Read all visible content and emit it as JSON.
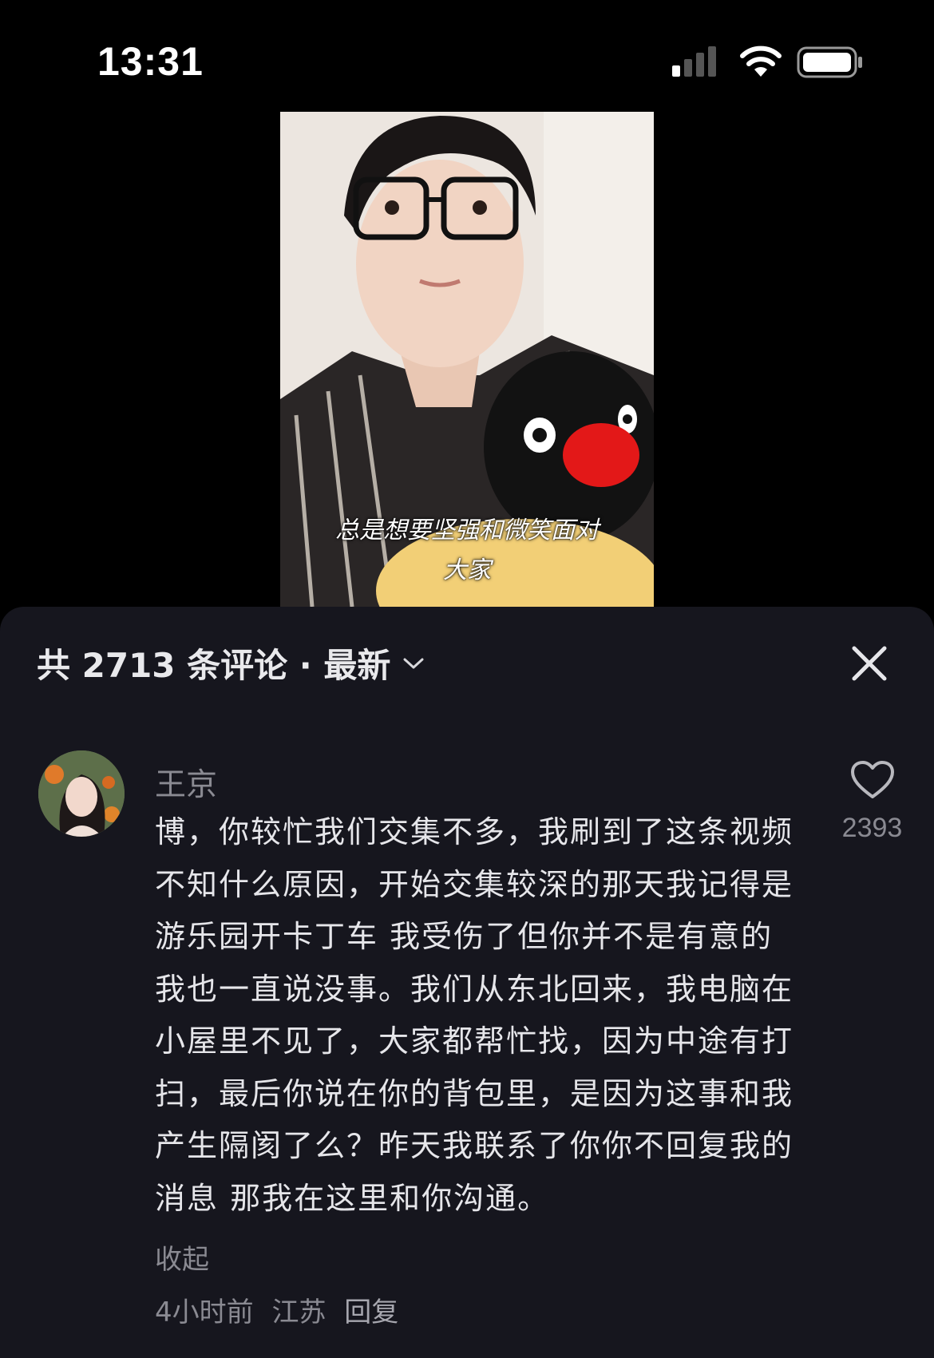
{
  "status_bar": {
    "time": "13:31"
  },
  "video": {
    "caption_line1": "总是想要坚强和微笑面对",
    "caption_line2": "大家"
  },
  "comments_panel": {
    "title": "共 2713 条评论 · 最新",
    "close_icon": "close-icon",
    "sort_icon": "chevron-down-icon"
  },
  "comment": {
    "username": "王京",
    "text": "博，你较忙我们交集不多，我刷到了这条视频不知什么原因，开始交集较深的那天我记得是游乐园开卡丁车 我受伤了但你并不是有意的我也一直说没事。我们从东北回来，我电脑在小屋里不见了，大家都帮忙找，因为中途有打扫，最后你说在你的背包里，是因为这事和我产生隔阂了么？昨天我联系了你你不回复我的消息 那我在这里和你沟通。",
    "collapse_label": "收起",
    "time_ago": "4小时前",
    "location": "江苏",
    "reply_label": "回复",
    "like_count": "2393",
    "like_icon": "heart-icon"
  }
}
